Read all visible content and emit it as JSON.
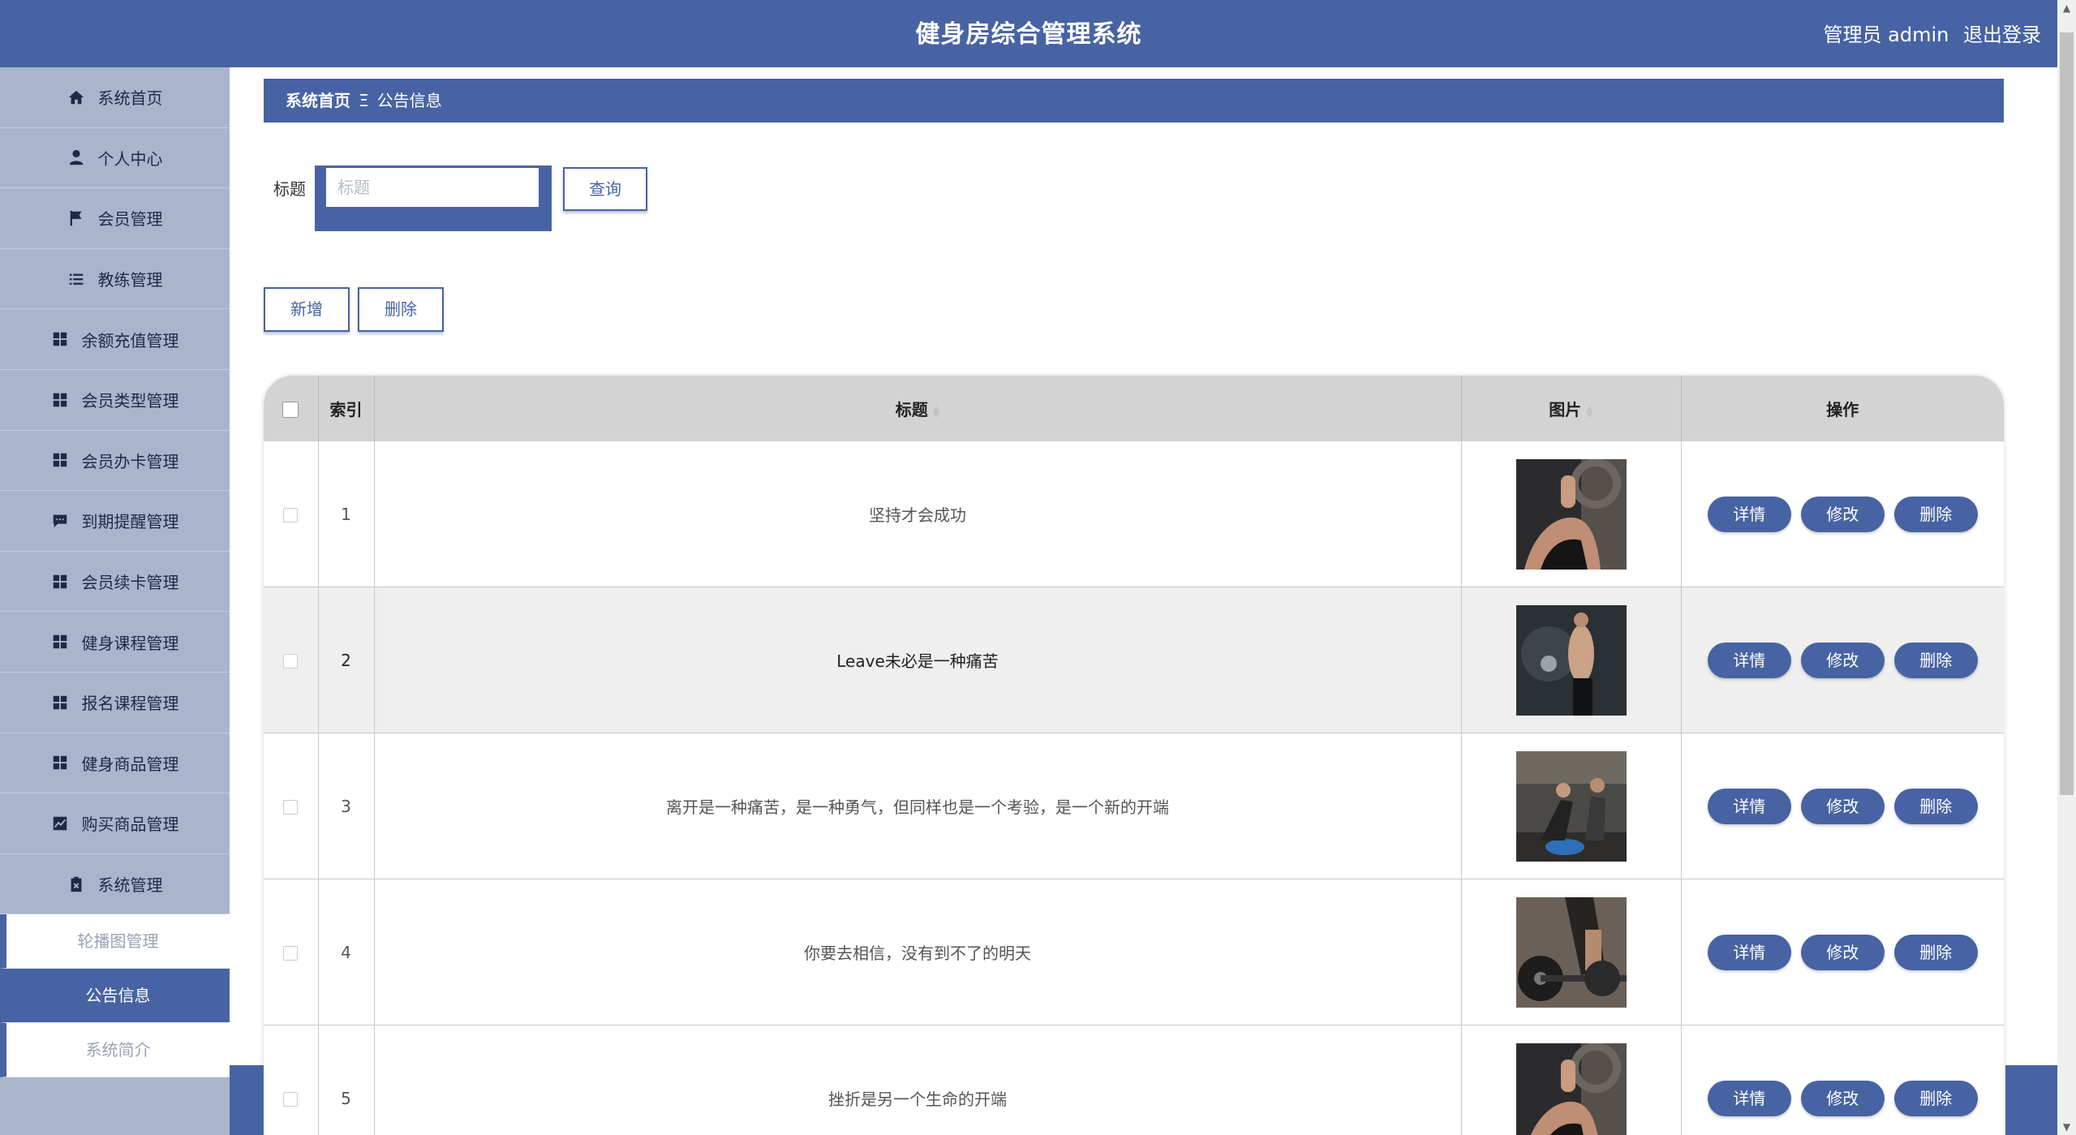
{
  "header": {
    "title": "健身房综合管理系统",
    "user_label": "管理员 admin",
    "logout": "退出登录"
  },
  "sidebar": {
    "items": [
      {
        "label": "系统首页",
        "icon": "home-icon"
      },
      {
        "label": "个人中心",
        "icon": "user-icon"
      },
      {
        "label": "会员管理",
        "icon": "flag-icon"
      },
      {
        "label": "教练管理",
        "icon": "list-icon"
      },
      {
        "label": "余额充值管理",
        "icon": "grid-icon"
      },
      {
        "label": "会员类型管理",
        "icon": "grid-icon"
      },
      {
        "label": "会员办卡管理",
        "icon": "grid-icon"
      },
      {
        "label": "到期提醒管理",
        "icon": "chat-icon"
      },
      {
        "label": "会员续卡管理",
        "icon": "grid-icon"
      },
      {
        "label": "健身课程管理",
        "icon": "grid-icon"
      },
      {
        "label": "报名课程管理",
        "icon": "grid-icon"
      },
      {
        "label": "健身商品管理",
        "icon": "grid-icon"
      },
      {
        "label": "购买商品管理",
        "icon": "chart-icon"
      },
      {
        "label": "系统管理",
        "icon": "clipboard-icon"
      }
    ],
    "submenu": [
      {
        "label": "轮播图管理"
      },
      {
        "label": "公告信息"
      },
      {
        "label": "系统简介"
      }
    ],
    "active_submenu": "公告信息"
  },
  "breadcrumb": {
    "home": "系统首页",
    "separator": "Ξ",
    "current": "公告信息"
  },
  "search": {
    "label": "标题",
    "placeholder": "标题",
    "value": "",
    "query_button": "查询"
  },
  "actions": {
    "add": "新增",
    "delete": "删除"
  },
  "table": {
    "columns": {
      "index": "索引",
      "title": "标题",
      "image": "图片",
      "ops": "操作"
    },
    "op_labels": {
      "detail": "详情",
      "edit": "修改",
      "delete": "删除"
    },
    "rows": [
      {
        "index": "1",
        "title": "坚持才会成功"
      },
      {
        "index": "2",
        "title": "Leave未必是一种痛苦"
      },
      {
        "index": "3",
        "title": "离开是一种痛苦，是一种勇气，但同样也是一个考验，是一个新的开端"
      },
      {
        "index": "4",
        "title": "你要去相信，没有到不了的明天"
      },
      {
        "index": "5",
        "title": "挫折是另一个生命的开端"
      }
    ]
  },
  "colors": {
    "primary": "#4763a3",
    "sidebar_bg": "#aab5cd",
    "table_header_bg": "#d3d3d3",
    "row_alt_bg": "#efefef"
  }
}
